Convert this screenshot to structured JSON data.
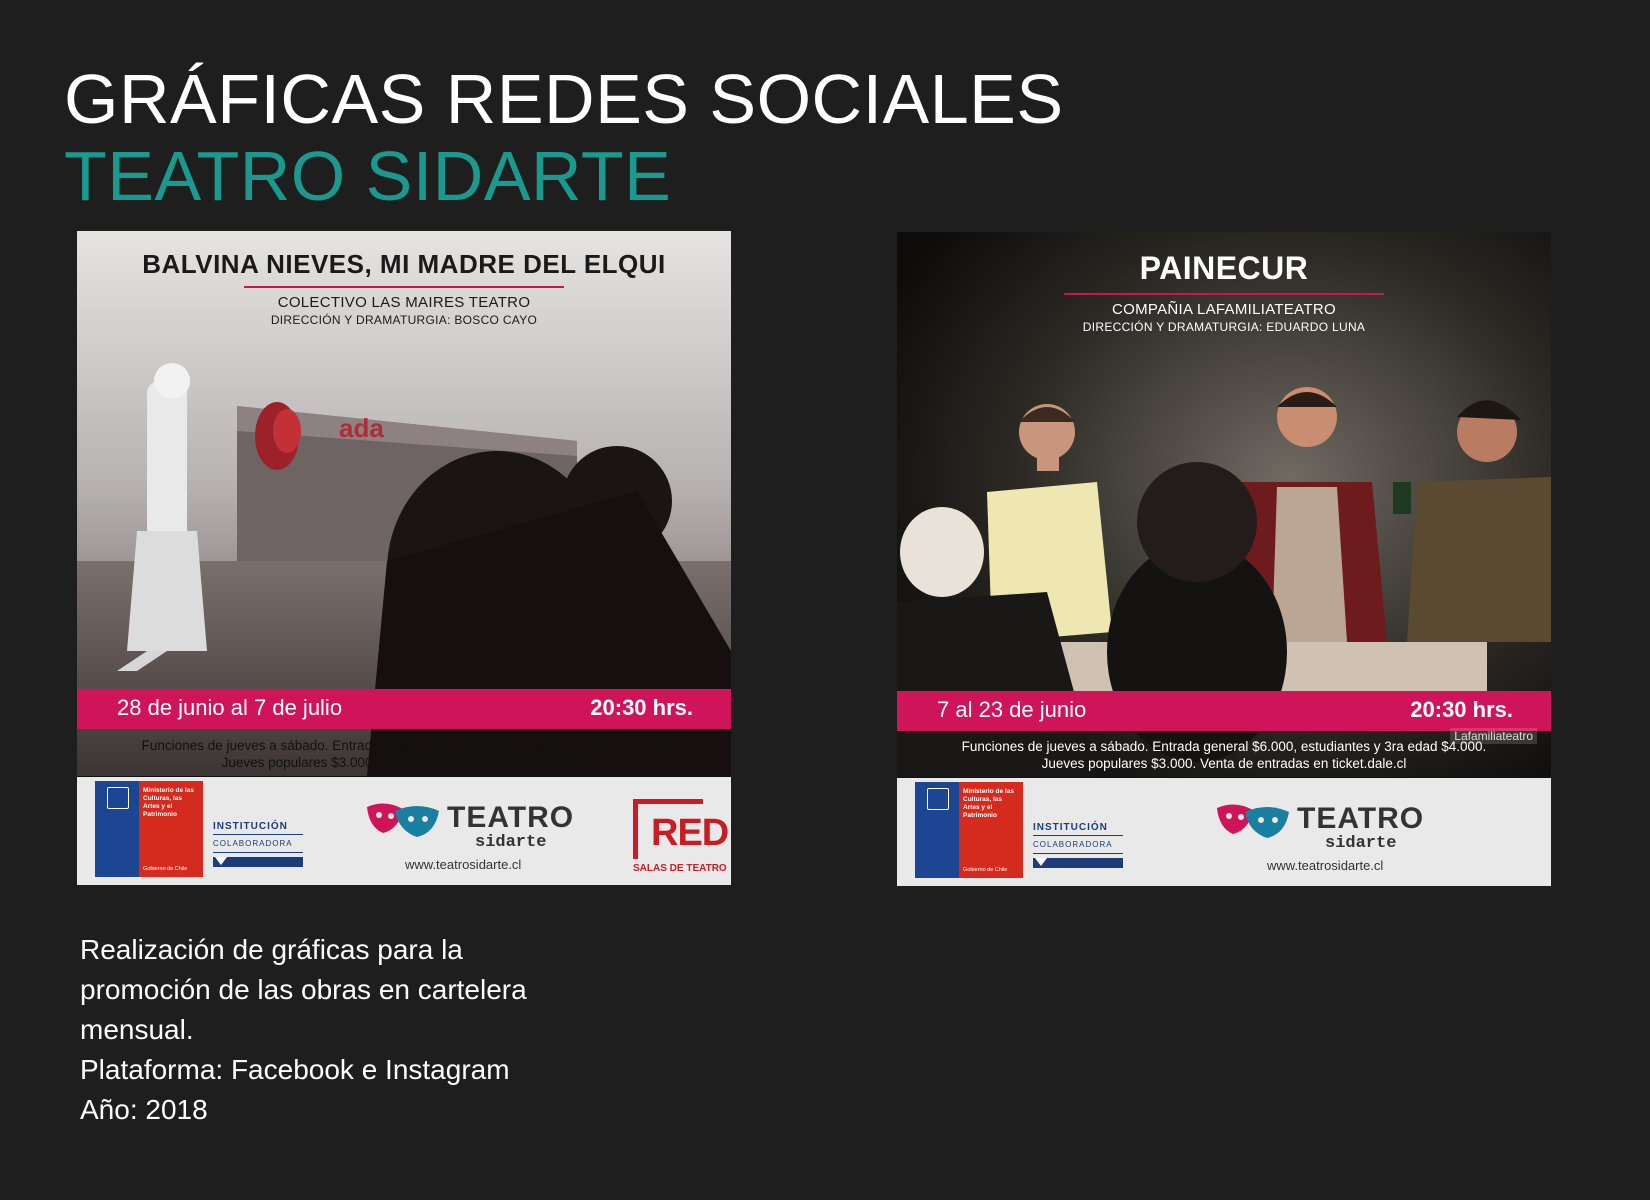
{
  "header": {
    "title": "GRÁFICAS REDES SOCIALES",
    "subtitle": "TEATRO SIDARTE"
  },
  "posters": [
    {
      "title": "BALVINA NIEVES, MI MADRE DEL ELQUI",
      "company": "COLECTIVO LAS MAIRES TEATRO",
      "direction": "DIRECCIÓN Y DRAMATURGIA: BOSCO CAYO",
      "dates": "28 de junio al 7 de julio",
      "time": "20:30 hrs.",
      "info_line1": "Funciones de jueves a sábado. Entrada general $6.000, estudiantes y 3ra edad $4.000.",
      "info_line2": "Jueves populares $3.000. Venta de entradas en ticket.dale.cl",
      "photo_sign": "ada"
    },
    {
      "title": "PAINECUR",
      "company": "COMPAÑIA LAFAMILIATEATRO",
      "direction": "DIRECCIÓN Y DRAMATURGIA: EDUARDO LUNA",
      "dates": "7 al 23 de junio",
      "time": "20:30 hrs.",
      "info_line1": "Funciones de jueves a sábado. Entrada general $6.000, estudiantes y 3ra edad $4.000.",
      "info_line2": "Jueves populares $3.000. Venta de entradas en ticket.dale.cl",
      "watermark": "Lafamiliateatro"
    }
  ],
  "sponsor": {
    "ministry": "Ministerio de las Culturas, las Artes y el Patrimonio",
    "government": "Gobierno de Chile",
    "institution_line1": "INSTITUCIÓN",
    "institution_line2": "COLABORADORA",
    "teatro": "TEATRO",
    "sidarte": "sidarte",
    "url": "www.teatrosidarte.cl",
    "red_word": "RED",
    "red_sub": "SALAS DE TEATRO"
  },
  "description": {
    "line1": "Realización de gráficas para la",
    "line2": "promoción de las obras en cartelera",
    "line3": "mensual.",
    "line4": "Plataforma: Facebook e Instagram",
    "line5": "Año: 2018"
  },
  "colors": {
    "background": "#1e1e1e",
    "accent_teal": "#1a9a8e",
    "band_pink": "#d0145a"
  }
}
